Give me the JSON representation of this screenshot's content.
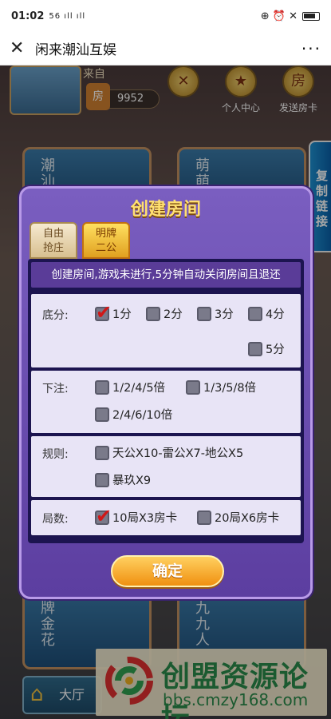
{
  "status": {
    "time": "01:02",
    "signal": "56 ıll ıll",
    "icons": "⊕ ⏰ ✕"
  },
  "titlebar": {
    "close_icon": "✕",
    "title": "闲来潮汕互娱",
    "more_icon": "···"
  },
  "game": {
    "nickname": "来自",
    "room_card_icon": "房",
    "room_card_count": "9952",
    "top_icons": [
      {
        "label": "",
        "glyph": "✕"
      },
      {
        "label": "个人中心",
        "glyph": "★"
      },
      {
        "label": "发送房卡",
        "glyph": "房"
      }
    ],
    "tiles": [
      {
        "label": "潮汕"
      },
      {
        "label": "萌萌"
      },
      {
        "label": "牌金花"
      },
      {
        "label": "九九人"
      }
    ],
    "side_tab": "复制链接",
    "hall_button": "大厅"
  },
  "dialog": {
    "title": "创建房间",
    "tabs": [
      {
        "line1": "自由",
        "line2": "抢庄"
      },
      {
        "line1": "明牌",
        "line2": "二公"
      }
    ],
    "notice": "创建房间,游戏未进行,5分钟自动关闭房间且退还",
    "base_score": {
      "label": "底分:",
      "options": [
        "1分",
        "2分",
        "3分",
        "4分",
        "5分"
      ]
    },
    "bet": {
      "label": "下注:",
      "options": [
        "1/2/4/5倍",
        "1/3/5/8倍",
        "2/4/6/10倍"
      ]
    },
    "rules": {
      "label": "规则:",
      "options": [
        "天公X10-雷公X7-地公X5",
        "暴玖X9"
      ]
    },
    "rounds": {
      "label": "局数:",
      "options": [
        "10局X3房卡",
        "20局X6房卡"
      ]
    },
    "confirm": "确定"
  },
  "watermark": {
    "title": "创盟资源论坛",
    "url": "bbs.cmzy168.com"
  }
}
